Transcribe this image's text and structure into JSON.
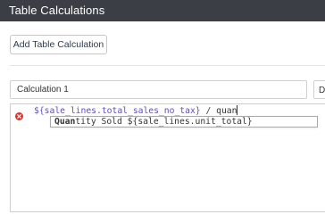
{
  "dialog": {
    "title": "Table Calculations"
  },
  "toolbar": {
    "add_label": "Add Table Calculation"
  },
  "calculation": {
    "name": "Calculation 1",
    "second_field_text": "De"
  },
  "editor": {
    "has_error": true,
    "expression_field": "${sale_lines.total_sales_no_tax}",
    "expression_operator": " / ",
    "expression_typed": "quan"
  },
  "autocomplete": {
    "options": [
      {
        "match": "Quan",
        "rest": "tity Sold ${sale_lines.unit_total}"
      }
    ]
  },
  "colors": {
    "titlebar_bg": "#3b3f45",
    "error_red": "#d9342b",
    "field_purple": "#5e4fb8"
  },
  "icons": {
    "error": "error-circle-x-icon"
  }
}
